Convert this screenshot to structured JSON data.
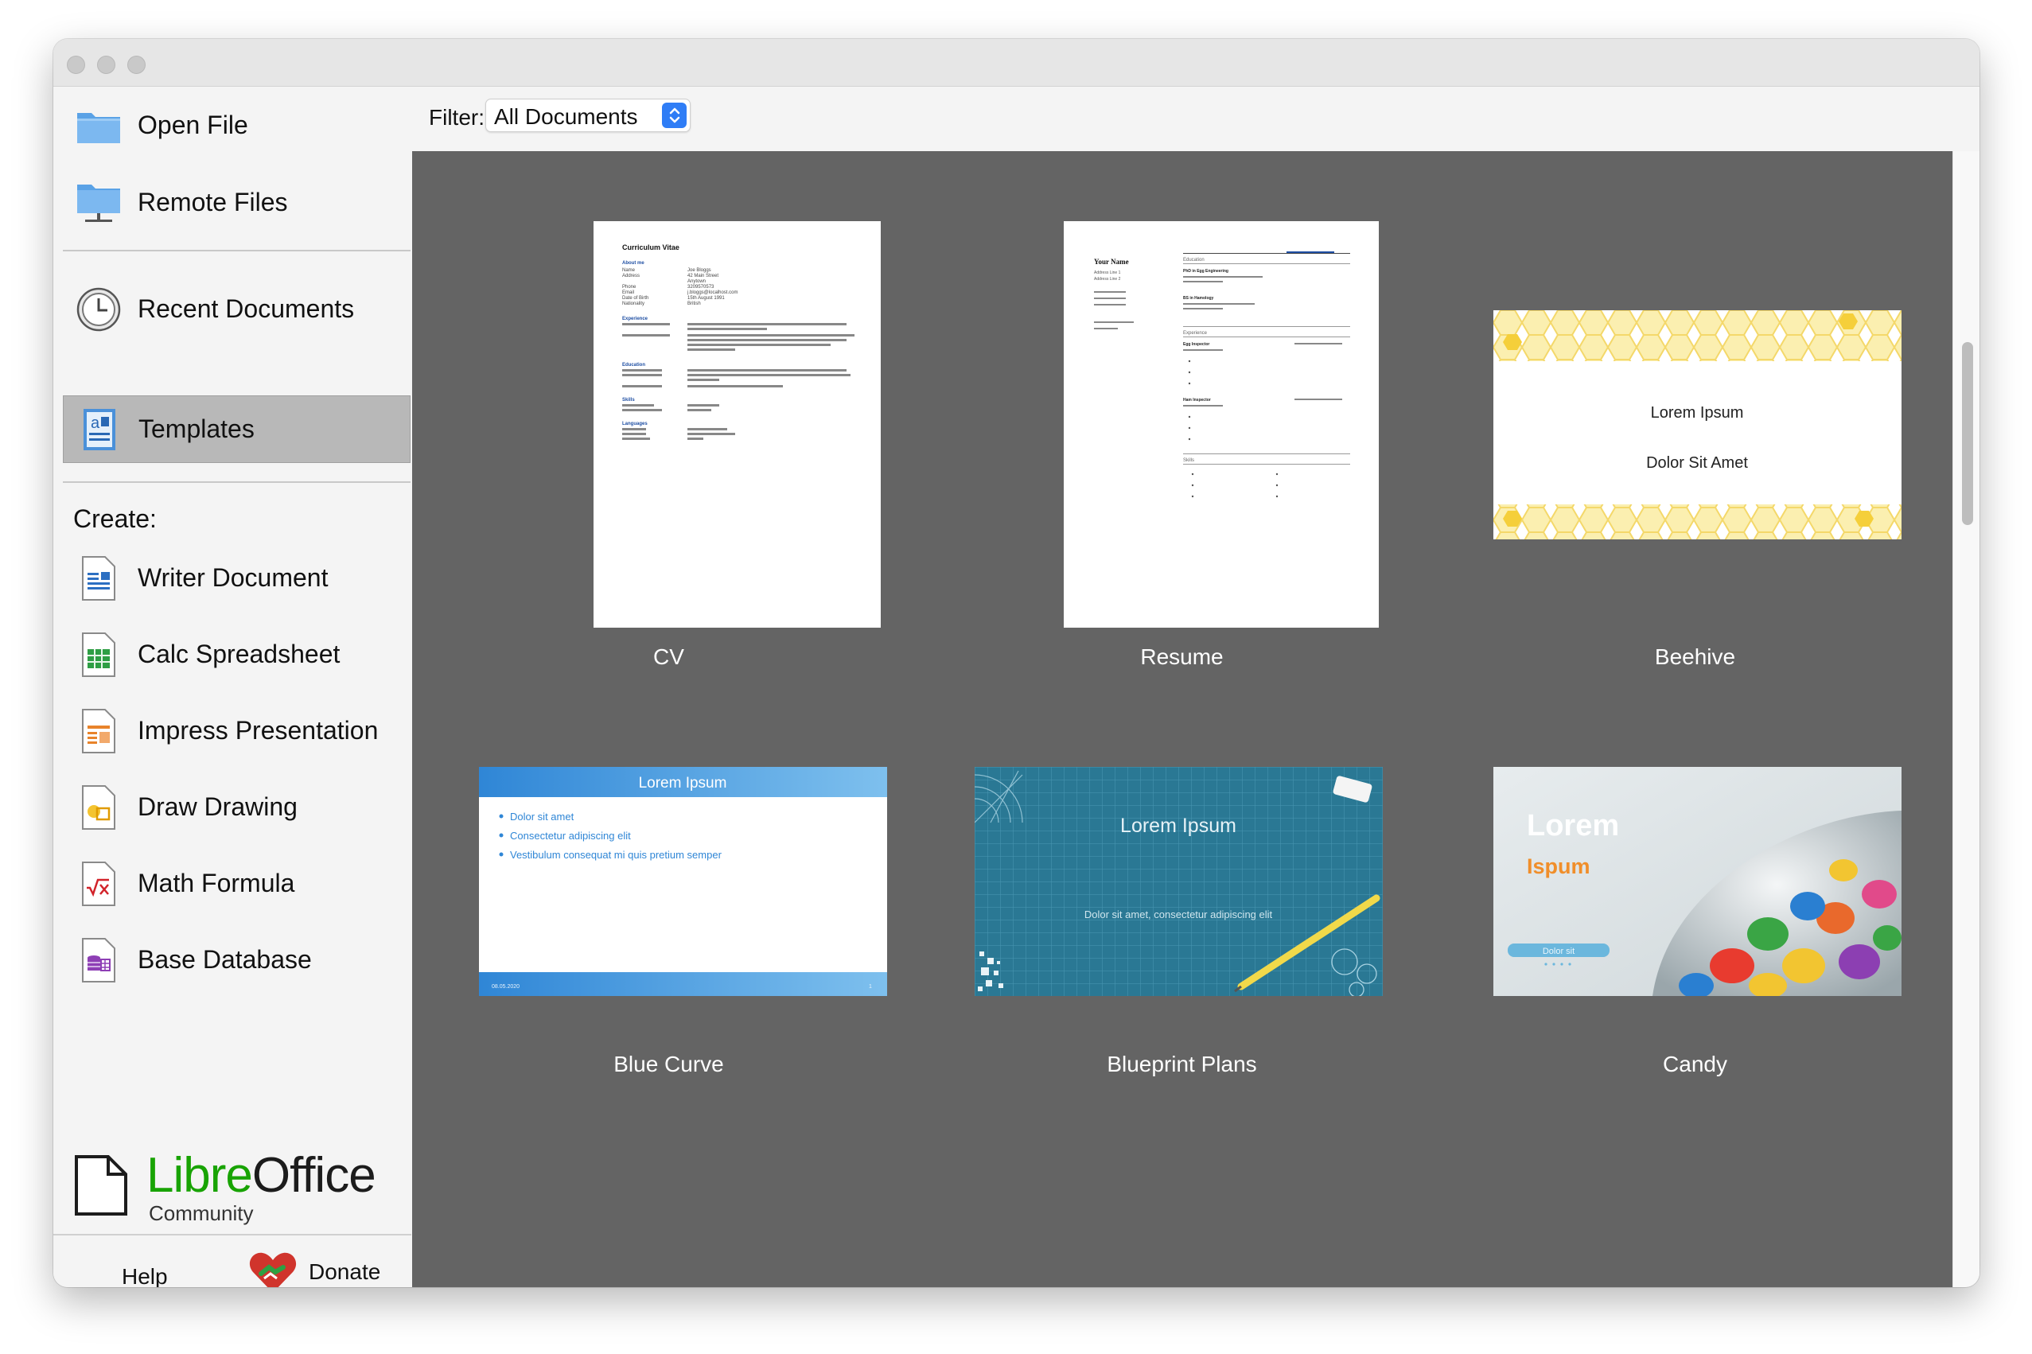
{
  "window": {
    "controls": [
      "close",
      "minimize",
      "maximize"
    ]
  },
  "sidebar": {
    "nav": [
      {
        "id": "open-file",
        "label": "Open File",
        "icon": "folder-icon"
      },
      {
        "id": "remote-files",
        "label": "Remote Files",
        "icon": "network-folder-icon"
      },
      {
        "id": "recent-documents",
        "label": "Recent Documents",
        "icon": "clock-icon"
      },
      {
        "id": "templates",
        "label": "Templates",
        "icon": "template-icon",
        "active": true
      }
    ],
    "create_label": "Create:",
    "create_items": [
      {
        "id": "writer-document",
        "label": "Writer Document",
        "icon": "writer-doc-icon"
      },
      {
        "id": "calc-spreadsheet",
        "label": "Calc Spreadsheet",
        "icon": "calc-sheet-icon"
      },
      {
        "id": "impress-presentation",
        "label": "Impress Presentation",
        "icon": "impress-presentation-icon"
      },
      {
        "id": "draw-drawing",
        "label": "Draw Drawing",
        "icon": "draw-drawing-icon"
      },
      {
        "id": "math-formula",
        "label": "Math Formula",
        "icon": "math-formula-icon"
      },
      {
        "id": "base-database",
        "label": "Base Database",
        "icon": "base-database-icon"
      }
    ],
    "logo": {
      "libre": "Libre",
      "office": "Office",
      "community": "Community"
    },
    "help_label": "Help",
    "donate_label": "Donate"
  },
  "filter": {
    "label": "Filter:",
    "selected": "All Documents"
  },
  "templates": [
    {
      "name": "CV"
    },
    {
      "name": "Resume"
    },
    {
      "name": "Beehive",
      "line1": "Lorem Ipsum",
      "line2": "Dolor Sit Amet"
    },
    {
      "name": "Blue Curve",
      "title": "Lorem Ipsum",
      "bullets": [
        "Dolor sit amet",
        "Consectetur adipiscing elit",
        "Vestibulum consequat mi quis pretium semper"
      ],
      "footer_date": "08.05.2020",
      "footer_page": "1"
    },
    {
      "name": "Blueprint Plans",
      "title": "Lorem Ipsum",
      "subtitle": "Dolor sit amet, consectetur adipiscing elit"
    },
    {
      "name": "Candy",
      "title": "Lorem",
      "subtitle": "Ispum",
      "pill": "Dolor sit"
    }
  ],
  "cv_preview": {
    "heading": "Curriculum Vitae",
    "about": "About me",
    "fields": [
      "Name",
      "Address",
      "Phone",
      "Email",
      "Date of Birth",
      "Nationality"
    ],
    "values": [
      "Joe Bloggs",
      "42 Main Street",
      "Anytown",
      "3209570573",
      "j.bloggs@localhost.com",
      "15th August 1991",
      "British"
    ],
    "experience": "Experience",
    "education": "Education",
    "skills": "Skills",
    "languages": "Languages"
  },
  "resume_preview": {
    "name": "Your Name",
    "address1": "Address Line 1",
    "address2": "Address Line 2",
    "education": "Education",
    "experience": "Experience",
    "skills": "Skills",
    "degree1": "PhD in Egg Engineering",
    "degree2": "BS in Hamology",
    "job1": "Egg Inspector",
    "job2": "Ham Inspector"
  }
}
